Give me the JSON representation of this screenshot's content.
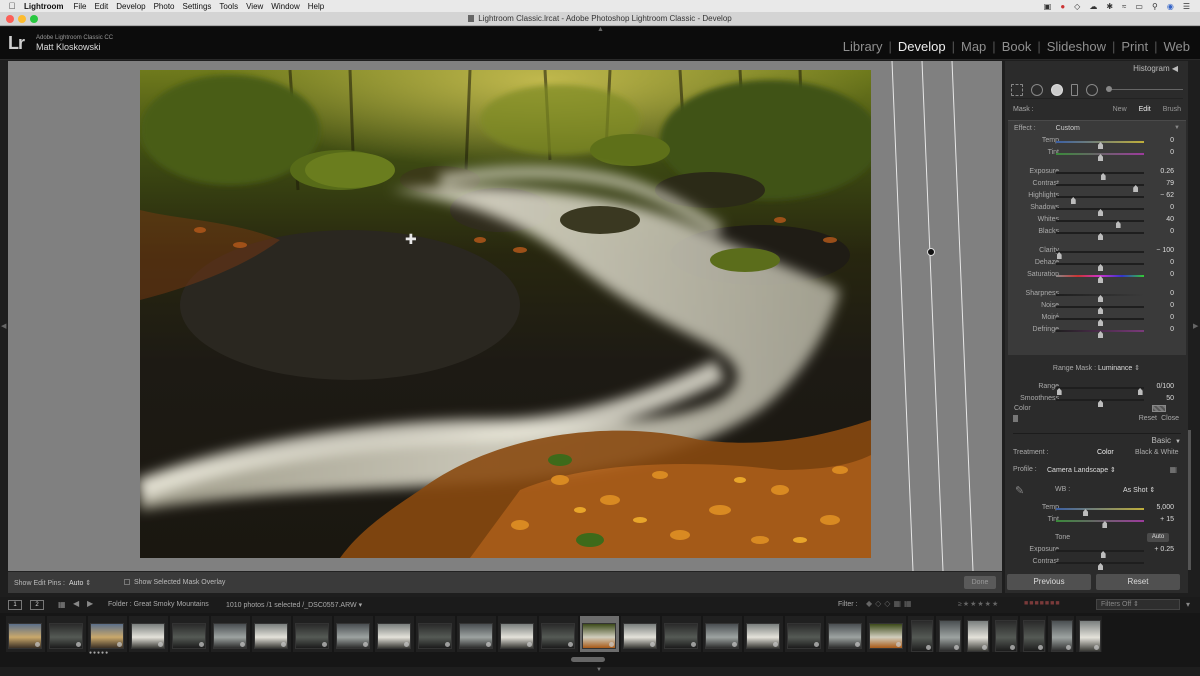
{
  "menubar": {
    "app": "Lightroom",
    "menus": [
      "File",
      "Edit",
      "Develop",
      "Photo",
      "Settings",
      "Tools",
      "View",
      "Window",
      "Help"
    ]
  },
  "window": {
    "title": "Lightroom Classic.lrcat - Adobe Photoshop Lightroom Classic - Develop"
  },
  "identity": {
    "logo": "Lr",
    "product": "Adobe Lightroom Classic CC",
    "user": "Matt Kloskowski"
  },
  "modules": [
    {
      "label": "Library",
      "active": false
    },
    {
      "label": "Develop",
      "active": true
    },
    {
      "label": "Map",
      "active": false
    },
    {
      "label": "Book",
      "active": false
    },
    {
      "label": "Slideshow",
      "active": false
    },
    {
      "label": "Print",
      "active": false
    },
    {
      "label": "Web",
      "active": false
    }
  ],
  "toolbar": {
    "show_pins_label": "Show Edit Pins :",
    "show_pins_value": "Auto",
    "mask_overlay_label": "Show Selected Mask Overlay",
    "done_label": "Done"
  },
  "right_panel": {
    "histogram_label": "Histogram",
    "mask_label": "Mask :",
    "mask_options": [
      "New",
      "Edit",
      "Brush"
    ],
    "effect_label": "Effect :",
    "effect_value": "Custom",
    "sliders": [
      {
        "label": "Temp",
        "value": "0",
        "pos": 0.5
      },
      {
        "label": "Tint",
        "value": "0",
        "pos": 0.5
      },
      {
        "label": "Exposure",
        "value": "0.26",
        "pos": 0.53
      },
      {
        "label": "Contrast",
        "value": "79",
        "pos": 0.9
      },
      {
        "label": "Highlights",
        "value": "− 62",
        "pos": 0.19
      },
      {
        "label": "Shadows",
        "value": "0",
        "pos": 0.5
      },
      {
        "label": "Whites",
        "value": "40",
        "pos": 0.7
      },
      {
        "label": "Blacks",
        "value": "0",
        "pos": 0.5
      },
      {
        "label": "Clarity",
        "value": "− 100",
        "pos": 0.03
      },
      {
        "label": "Dehaze",
        "value": "0",
        "pos": 0.5
      },
      {
        "label": "Saturation",
        "value": "0",
        "pos": 0.5
      },
      {
        "label": "Sharpness",
        "value": "0",
        "pos": 0.5
      },
      {
        "label": "Noise",
        "value": "0",
        "pos": 0.5
      },
      {
        "label": "Moiré",
        "value": "0",
        "pos": 0.5
      },
      {
        "label": "Defringe",
        "value": "0",
        "pos": 0.5
      }
    ],
    "color_label": "Color",
    "range_mask_label": "Range Mask :",
    "range_mask_value": "Luminance",
    "range_label": "Range",
    "range_value": "0/100",
    "smoothness_label": "Smoothness",
    "smoothness_value": "50",
    "smoothness_pos": 0.5,
    "reset_label": "Reset",
    "close_label": "Close",
    "basic_label": "Basic",
    "treatment_label": "Treatment :",
    "treatment_color": "Color",
    "treatment_bw": "Black & White",
    "profile_label": "Profile :",
    "profile_value": "Camera Landscape",
    "wb_label": "WB :",
    "wb_value": "As Shot",
    "basic_sliders": [
      {
        "label": "Temp",
        "value": "5,000",
        "pos": 0.33
      },
      {
        "label": "Tint",
        "value": "+ 15",
        "pos": 0.55
      }
    ],
    "tone_label": "Tone",
    "auto_label": "Auto",
    "tone_sliders": [
      {
        "label": "Exposure",
        "value": "+ 0.25",
        "pos": 0.53
      },
      {
        "label": "Contrast",
        "value": "",
        "pos": 0.5
      }
    ],
    "previous_label": "Previous",
    "reset_button_label": "Reset"
  },
  "filmstrip_bar": {
    "view1": "1",
    "view2": "2",
    "folder": "Folder : Great Smoky Mountains",
    "count": "1010 photos /1 selected /_DSC0557.ARW",
    "filter_label": "Filter :",
    "filters_off": "Filters Off"
  },
  "colors": {
    "accent_active": "#eeeeee",
    "panel_bg": "#2b2b2b",
    "workarea_bg": "#808080"
  },
  "filmstrip": {
    "thumbs": [
      {
        "kind": "sunset",
        "portrait": false
      },
      {
        "kind": "dark",
        "portrait": false
      },
      {
        "kind": "sunset",
        "portrait": false
      },
      {
        "kind": "bright",
        "portrait": false
      },
      {
        "kind": "dark",
        "portrait": false
      },
      {
        "kind": "mid",
        "portrait": false
      },
      {
        "kind": "bright",
        "portrait": false
      },
      {
        "kind": "dark",
        "portrait": false
      },
      {
        "kind": "mid",
        "portrait": false
      },
      {
        "kind": "bright",
        "portrait": false
      },
      {
        "kind": "dark",
        "portrait": false
      },
      {
        "kind": "mid",
        "portrait": false
      },
      {
        "kind": "bright",
        "portrait": false
      },
      {
        "kind": "dark",
        "portrait": false
      },
      {
        "kind": "autumn",
        "portrait": false,
        "selected": true
      },
      {
        "kind": "bright",
        "portrait": false
      },
      {
        "kind": "dark",
        "portrait": false
      },
      {
        "kind": "mid",
        "portrait": false
      },
      {
        "kind": "bright",
        "portrait": false
      },
      {
        "kind": "dark",
        "portrait": false
      },
      {
        "kind": "mid",
        "portrait": false
      },
      {
        "kind": "autumn",
        "portrait": false
      },
      {
        "kind": "dark",
        "portrait": true
      },
      {
        "kind": "mid",
        "portrait": true
      },
      {
        "kind": "bright",
        "portrait": true
      },
      {
        "kind": "dark",
        "portrait": true
      },
      {
        "kind": "dark",
        "portrait": true
      },
      {
        "kind": "mid",
        "portrait": true
      },
      {
        "kind": "bright",
        "portrait": true
      }
    ]
  }
}
